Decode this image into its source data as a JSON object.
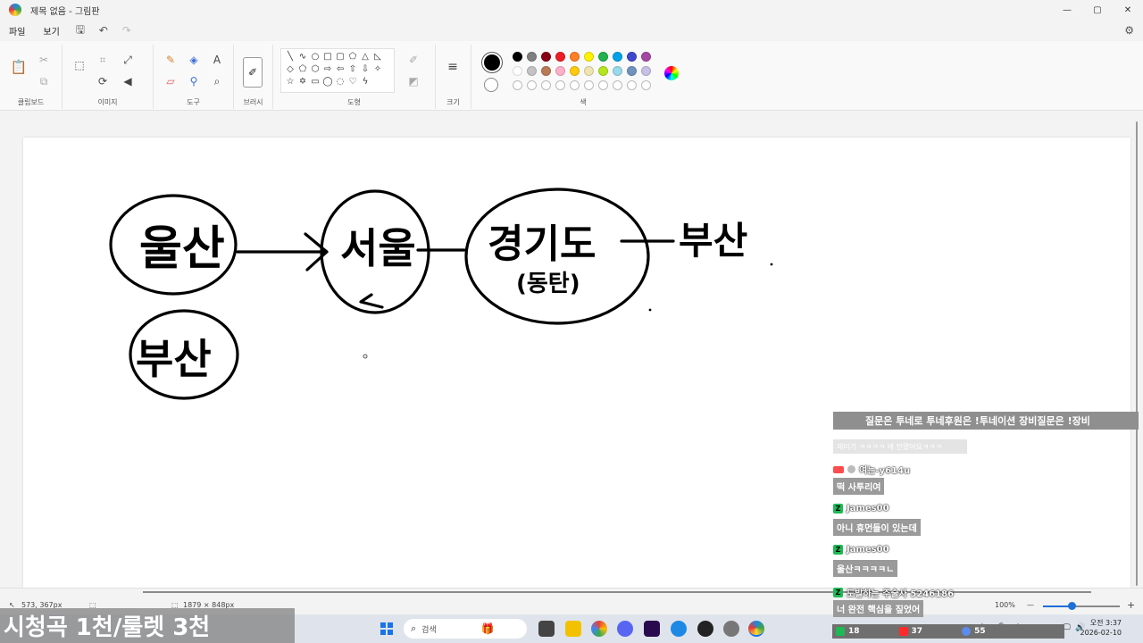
{
  "window": {
    "title": "제목 없음 - 그림판",
    "minimize": "—",
    "maximize": "▢",
    "close": "✕"
  },
  "menu": {
    "file": "파일",
    "view": "보기"
  },
  "ribbon": {
    "clipboard": "클립보드",
    "image": "이미지",
    "tools": "도구",
    "brushes": "브러시",
    "shapes": "도형",
    "size": "크기",
    "colors": "색",
    "palette_row1": [
      "#000000",
      "#7f7f7f",
      "#880015",
      "#ed1c24",
      "#ff7f27",
      "#fff200",
      "#22b14c",
      "#00a2e8",
      "#3f48cc",
      "#a349a4"
    ],
    "palette_row2": [
      "#ffffff",
      "#c3c3c3",
      "#b97a57",
      "#ffaec9",
      "#ffc90e",
      "#efe4b0",
      "#b5e61d",
      "#99d9ea",
      "#7092be",
      "#c8bfe7"
    ]
  },
  "canvas": {
    "words": {
      "ulsan": "울산",
      "seoul": "서울",
      "gyeonggi": "경기도",
      "dongtan": "(동탄)",
      "busan_right": "부산",
      "busan_left": "부산"
    }
  },
  "status": {
    "cursor_pos": "573, 367px",
    "canvas_size": "1879 × 848px",
    "zoom": "100%",
    "zoom_fraction": 0.37
  },
  "taskbar": {
    "search_placeholder": "검색",
    "time": "오전 3:37",
    "date": "2026-02-10",
    "lang": "A"
  },
  "overlay": {
    "banner": "질문은 투네로 투네후원은 !투네이션 장비질문은 !장비",
    "blurred": "재미가 ㅋㅋㅋㅋ 왜 안됐어요ㅋㅋㅋ",
    "chat": [
      {
        "name": "여는-y614u",
        "msg": "떡 사투리여"
      },
      {
        "name": "James00",
        "msg": "아니 휴먼들이 있는데"
      },
      {
        "name": "James00",
        "msg": "울산ㅋㅋㅋㅋㄴ"
      },
      {
        "name": "도발하는 주술사 5246186",
        "msg": "너 완전 핵심을 짚었어"
      }
    ],
    "bottom_left": "시청곡 1천/룰렛 3천",
    "stat_viewers": "18",
    "stat_yt": "37",
    "stat_other": "55"
  }
}
